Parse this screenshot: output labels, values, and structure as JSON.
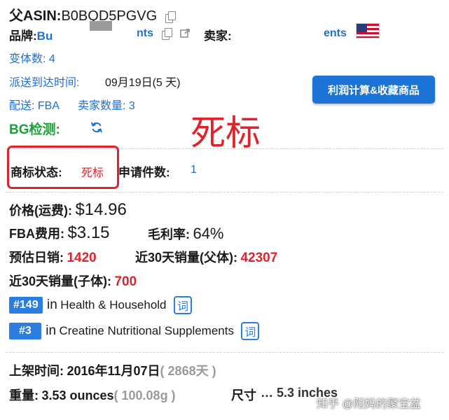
{
  "header": {
    "parent_asin_label": "父ASIN:",
    "parent_asin_value": "B0BQD5PGVG",
    "brand_label": "品牌:",
    "brand_start": "Bu",
    "brand_end": "nts",
    "seller_label": "卖家:",
    "seller_end": "ents",
    "flag_icon": "us-flag-icon"
  },
  "info": {
    "variants": "变体数: 4",
    "delivery_label": "派送到达时间:",
    "delivery_value": "09月19日(5 天)",
    "fulfillment": "配送: FBA",
    "seller_count": "卖家数量: 3",
    "bg_label": "BG检测:",
    "profit_button": "利润计算&收藏商品",
    "dead_mark": "死标"
  },
  "trademark": {
    "status_label": "商标状态:",
    "status_value": "死标",
    "applications_label": "申请件数:",
    "applications_value": "1"
  },
  "pricing": {
    "price_label": "价格(运费):",
    "price_value": "$14.96",
    "fba_label": "FBA费用:",
    "fba_value": "$3.15",
    "margin_label": "毛利率:",
    "margin_value": "64%",
    "daily_sales_label": "预估日销:",
    "daily_sales_value": "1420",
    "parent_sales_label": "近30天销量(父体):",
    "parent_sales_value": "42307",
    "child_sales_label": "近30天销量(子体):",
    "child_sales_value": "700"
  },
  "ranks": [
    {
      "rank": "#149",
      "in": "in",
      "category": "Health & Household",
      "icon_label": "词"
    },
    {
      "rank": "#3",
      "in": "in",
      "category": "Creatine Nutritional Supplements",
      "icon_label": "词"
    }
  ],
  "listing": {
    "date_label": "上架时间:",
    "date_value": "2016年11月07日",
    "days_value": "( 2868天 )",
    "weight_label": "重量:",
    "weight_value": "3.53 ounces",
    "weight_grams": "( 100.08g )",
    "size_partial": "尺寸",
    "size_value": "… 5.3 inches"
  },
  "watermark": "知乎 @阳妈的聚宝盆",
  "colors": {
    "accent_blue": "#1f6fd1",
    "alert_red": "#e0222a",
    "bg_green": "#1e9e3a",
    "button_blue": "#1b74d6"
  }
}
